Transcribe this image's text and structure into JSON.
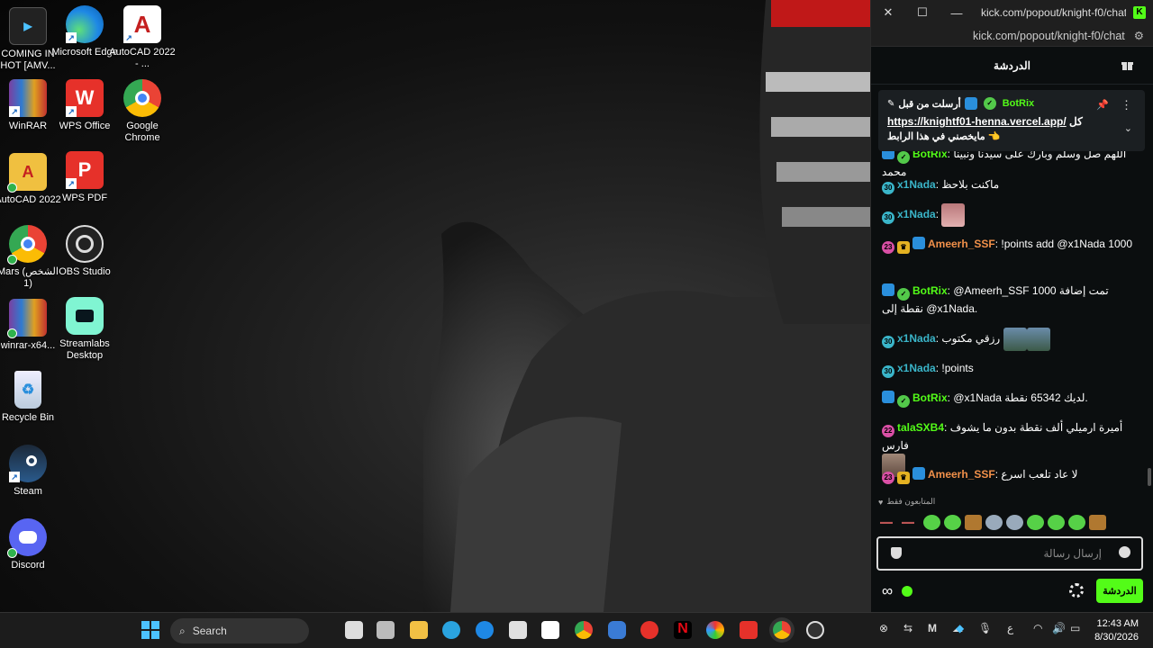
{
  "desktop": {
    "icons": [
      {
        "label": "COMING IN HOT [AMV...",
        "icon": "video-file-icon"
      },
      {
        "label": "Microsoft Edge",
        "icon": "edge-icon"
      },
      {
        "label": "AutoCAD 2022 - ...",
        "icon": "autocad-icon"
      },
      {
        "label": "WinRAR",
        "icon": "winrar-icon"
      },
      {
        "label": "WPS Office",
        "icon": "wps-office-icon"
      },
      {
        "label": "Google Chrome",
        "icon": "chrome-icon"
      },
      {
        "label": "AutoCAD 2022",
        "icon": "autocad-folder-icon"
      },
      {
        "label": "WPS PDF",
        "icon": "wps-pdf-icon"
      },
      {
        "label": "Mars (الشخص 1)",
        "icon": "chrome-profile-icon"
      },
      {
        "label": "OBS Studio",
        "icon": "obs-icon"
      },
      {
        "label": "winrar-x64...",
        "icon": "winrar-installer-icon"
      },
      {
        "label": "Streamlabs Desktop",
        "icon": "streamlabs-icon"
      },
      {
        "label": "Recycle Bin",
        "icon": "recycle-bin-icon"
      },
      {
        "label": "Steam",
        "icon": "steam-icon"
      },
      {
        "label": "Discord",
        "icon": "discord-icon"
      }
    ]
  },
  "browser": {
    "title": "kick.com/popout/knight-f0/chat - Go...",
    "url": "kick.com/popout/knight-f0/chat",
    "chat_header": "الدردشة",
    "pinned": {
      "sender_prefix": "أرسلت من قبل",
      "sender": "BotRix",
      "link_text": "https://knightf01-henna.vercel.app/",
      "word_before": "كل",
      "line2": "مايخصني في هذا الرابط"
    },
    "messages": [
      {
        "user": "BotRix",
        "text": "اللهم صل وسلم وبارك على سيدنا ونبينا محمد",
        "color": "#53fc18",
        "badges": [
          "bot",
          "verified"
        ]
      },
      {
        "user": "x1Nada",
        "text": "ماكنت بلاحظ",
        "color": "#3ab5c9",
        "badges": [
          "30"
        ]
      },
      {
        "user": "x1Nada",
        "text": "",
        "color": "#3ab5c9",
        "badges": [
          "30"
        ],
        "emote": true
      },
      {
        "user": "Ameerh_SSF",
        "text": "!points add @x1Nada 1000",
        "color": "#f1904a",
        "badges": [
          "23",
          "crown",
          "bot"
        ]
      },
      {
        "user": "BotRix",
        "text": "@Ameerh_SSF تمت إضافة 1000 نقطة إلى @x1Nada.",
        "color": "#53fc18",
        "badges": [
          "bot",
          "verified"
        ]
      },
      {
        "user": "x1Nada",
        "text": "رزقي مكتوب",
        "color": "#3ab5c9",
        "badges": [
          "30"
        ],
        "emote2": true
      },
      {
        "user": "x1Nada",
        "text": "!points",
        "color": "#3ab5c9",
        "badges": [
          "30"
        ]
      },
      {
        "user": "BotRix",
        "text": "@x1Nada لديك 65342 نقطة.",
        "color": "#53fc18",
        "badges": [
          "bot",
          "verified"
        ]
      },
      {
        "user": "talaSXB4",
        "text": "أميرة ارميلي ألف نقطة بدون ما يشوف فارس",
        "color": "#53fc18",
        "badges": [
          "22"
        ],
        "emote": true
      },
      {
        "user": "Ameerh_SSF",
        "text": "لا عاد تلعب اسرع",
        "color": "#f1904a",
        "badges": [
          "23",
          "crown",
          "bot"
        ]
      }
    ],
    "followers_only": "المتابعون فقط",
    "input_placeholder": "إرسال رسالة",
    "chat_button": "الدردشة"
  },
  "taskbar": {
    "search_placeholder": "Search",
    "time": "12:43 AM",
    "date": "8/30/2026",
    "lang": "ع"
  },
  "colors": {
    "kick_green": "#53fc18",
    "accent_blue": "#4cc2ff"
  }
}
